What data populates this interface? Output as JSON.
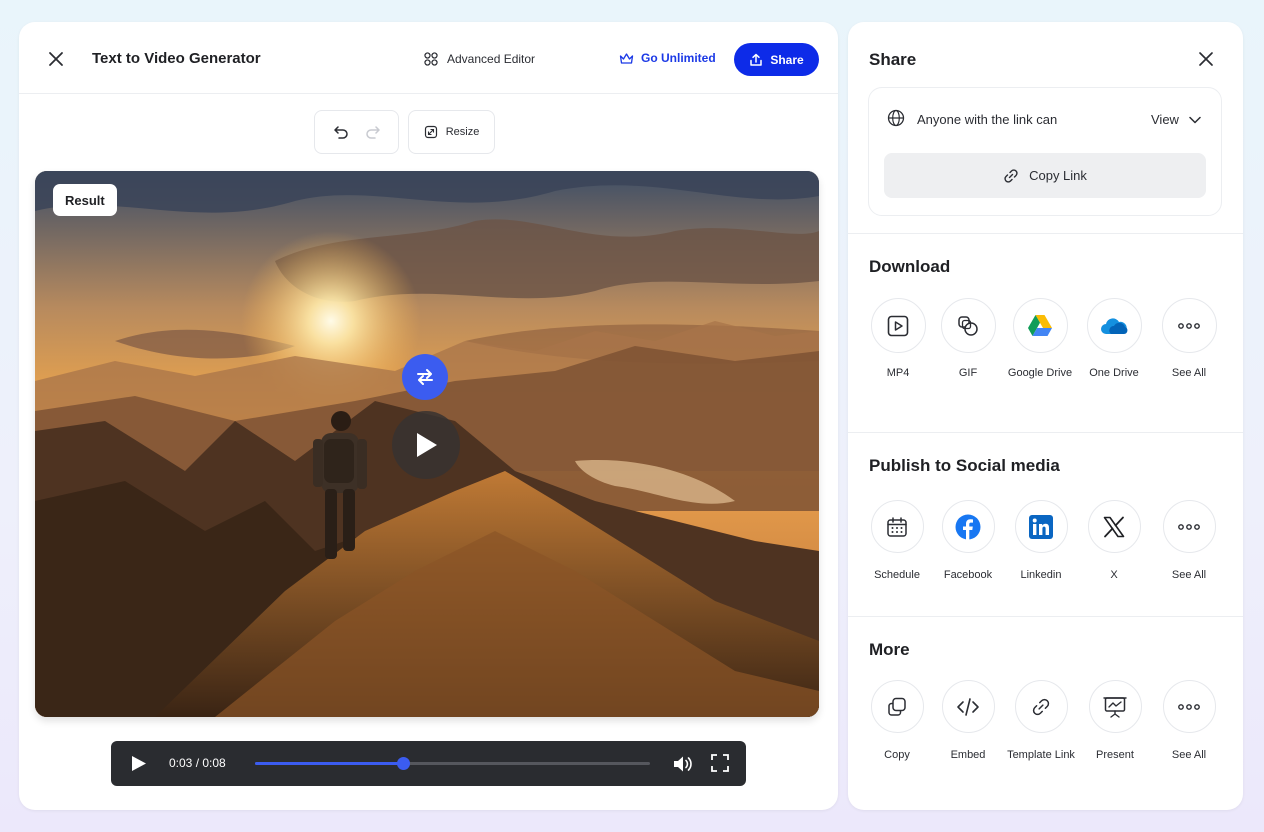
{
  "header": {
    "title": "Text to Video Generator",
    "advanced_editor": "Advanced Editor",
    "go_unlimited": "Go Unlimited",
    "share": "Share"
  },
  "toolbar": {
    "resize": "Resize"
  },
  "media": {
    "badge": "Result"
  },
  "player": {
    "time": "0:03 / 0:08",
    "progress": 0.375
  },
  "share_panel": {
    "title": "Share",
    "link_access": "Anyone with the link can",
    "permission": "View",
    "copy_link": "Copy Link"
  },
  "download": {
    "title": "Download",
    "items": [
      {
        "label": "MP4",
        "icon": "video-file-icon"
      },
      {
        "label": "GIF",
        "icon": "gif-icon"
      },
      {
        "label": "Google Drive",
        "icon": "google-drive-icon"
      },
      {
        "label": "One Drive",
        "icon": "onedrive-icon"
      },
      {
        "label": "See All",
        "icon": "more-icon"
      }
    ]
  },
  "social": {
    "title": "Publish to Social media",
    "items": [
      {
        "label": "Schedule",
        "icon": "calendar-icon"
      },
      {
        "label": "Facebook",
        "icon": "facebook-icon"
      },
      {
        "label": "Linkedin",
        "icon": "linkedin-icon"
      },
      {
        "label": "X",
        "icon": "x-icon"
      },
      {
        "label": "See All",
        "icon": "more-icon"
      }
    ]
  },
  "more": {
    "title": "More",
    "items": [
      {
        "label": "Copy",
        "icon": "copy-icon"
      },
      {
        "label": "Embed",
        "icon": "embed-icon"
      },
      {
        "label": "Template Link",
        "icon": "link-icon"
      },
      {
        "label": "Present",
        "icon": "present-icon"
      },
      {
        "label": "See All",
        "icon": "more-icon"
      }
    ]
  },
  "colors": {
    "accent": "#0d2be8",
    "swap": "#3b5cf0",
    "player_bg": "#2a2c30"
  }
}
